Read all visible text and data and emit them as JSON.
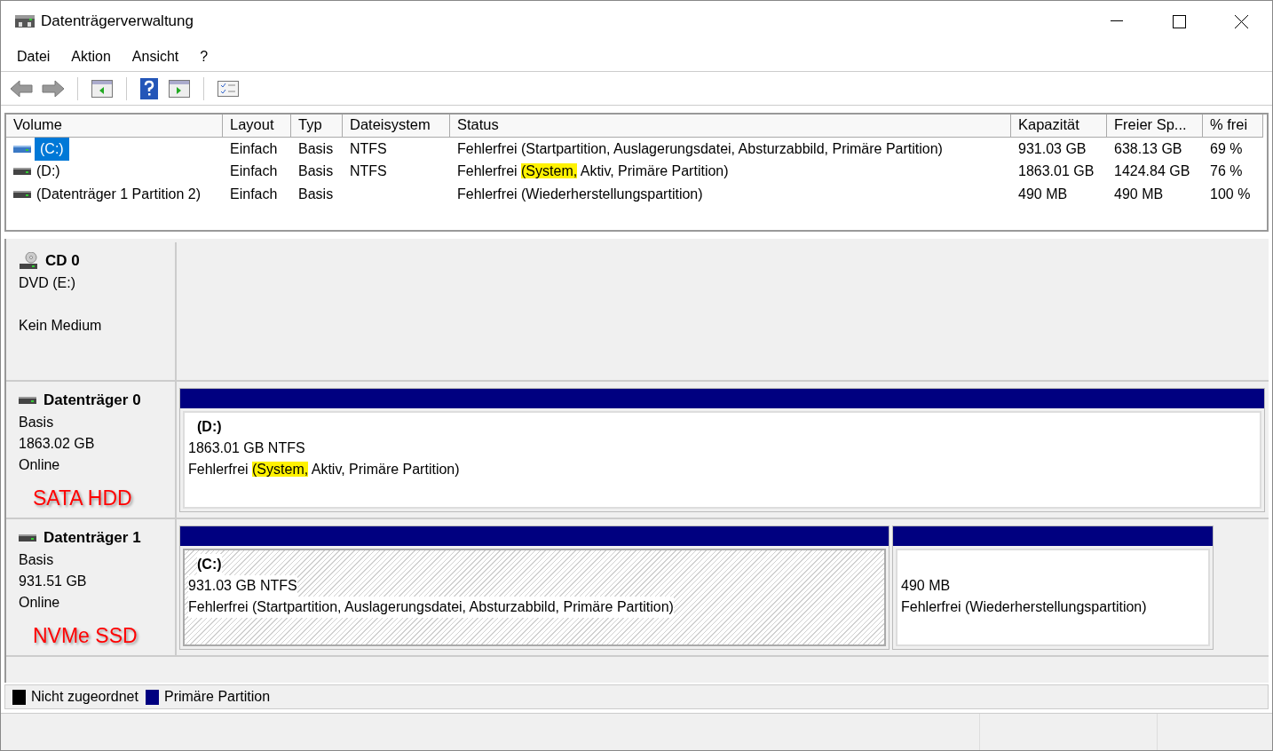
{
  "window": {
    "title": "Datenträgerverwaltung"
  },
  "menu": [
    "Datei",
    "Aktion",
    "Ansicht",
    "?"
  ],
  "volume_table": {
    "columns": [
      "Volume",
      "Layout",
      "Typ",
      "Dateisystem",
      "Status",
      "Kapazität",
      "Freier Sp...",
      "% frei"
    ],
    "rows": [
      {
        "selected": true,
        "cells": [
          "(C:)",
          "Einfach",
          "Basis",
          "NTFS",
          [
            {
              "text": "Fehlerfrei (Startpartition, Auslagerungsdatei, Absturzabbild, Primäre Partition)",
              "highlighted": false
            }
          ],
          "931.03 GB",
          "638.13 GB",
          "69 %"
        ]
      },
      {
        "selected": false,
        "cells": [
          "(D:)",
          "Einfach",
          "Basis",
          "NTFS",
          [
            {
              "text": "Fehlerfrei ",
              "highlighted": false
            },
            {
              "text": "(System,",
              "highlighted": true
            },
            {
              "text": " Aktiv, Primäre Partition)",
              "highlighted": false
            }
          ],
          "1863.01 GB",
          "1424.84 GB",
          "76 %"
        ]
      },
      {
        "selected": false,
        "cells": [
          "(Datenträger 1 Partition 2)",
          "Einfach",
          "Basis",
          "",
          [
            {
              "text": "Fehlerfrei (Wiederherstellungspartition)",
              "highlighted": false
            }
          ],
          "490 MB",
          "490 MB",
          "100 %"
        ]
      }
    ]
  },
  "disks": [
    {
      "kind": "optical",
      "name": "CD 0",
      "lines": [
        "DVD (E:)",
        "Kein Medium"
      ]
    },
    {
      "kind": "disk",
      "name": "Datenträger 0",
      "lines": [
        "Basis",
        "1863.02 GB",
        "Online"
      ],
      "annotation": "SATA HDD",
      "partitions": [
        {
          "selected": false,
          "title": "(D:)",
          "size": "1863.01 GB NTFS",
          "status": [
            {
              "text": "Fehlerfrei ",
              "highlighted": false
            },
            {
              "text": "(System,",
              "highlighted": true
            },
            {
              "text": " Aktiv, Primäre Partition)",
              "highlighted": false
            }
          ]
        }
      ]
    },
    {
      "kind": "disk",
      "name": "Datenträger 1",
      "lines": [
        "Basis",
        "931.51 GB",
        "Online"
      ],
      "annotation": "NVMe SSD",
      "partitions": [
        {
          "selected": true,
          "title": "(C:)",
          "size": "931.03 GB NTFS",
          "status": [
            {
              "text": "Fehlerfrei (Startpartition, Auslagerungsdatei, Absturzabbild, Primäre Partition)",
              "highlighted": false
            }
          ]
        },
        {
          "selected": false,
          "size": "490 MB",
          "status": [
            {
              "text": "Fehlerfrei (Wiederherstellungspartition)",
              "highlighted": false
            }
          ]
        }
      ]
    }
  ],
  "legend": [
    {
      "label": "Nicht zugeordnet",
      "color": "#000000"
    },
    {
      "label": "Primäre Partition",
      "color": "#000080"
    }
  ]
}
